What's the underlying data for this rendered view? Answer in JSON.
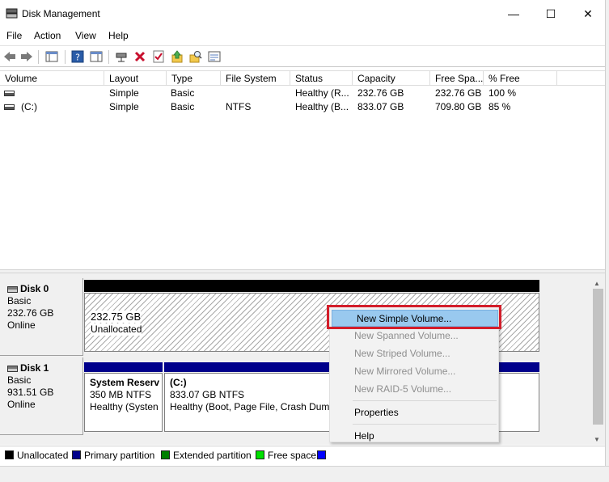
{
  "window": {
    "title": "Disk Management",
    "controls": {
      "minimize": "—",
      "maximize": "☐",
      "close": "✕"
    }
  },
  "menu": [
    "File",
    "Action",
    "View",
    "Help"
  ],
  "volume_list": {
    "columns": [
      "Volume",
      "Layout",
      "Type",
      "File System",
      "Status",
      "Capacity",
      "Free Spa...",
      "% Free"
    ],
    "rows": [
      {
        "volume": "",
        "layout": "Simple",
        "type": "Basic",
        "file_system": "",
        "status": "Healthy (R...",
        "capacity": "232.76 GB",
        "free": "232.76 GB",
        "pct_free": "100 %"
      },
      {
        "volume": "(C:)",
        "layout": "Simple",
        "type": "Basic",
        "file_system": "NTFS",
        "status": "Healthy (B...",
        "capacity": "833.07 GB",
        "free": "709.80 GB",
        "pct_free": "85 %"
      }
    ]
  },
  "disks": [
    {
      "name": "Disk 0",
      "type": "Basic",
      "size": "232.76 GB",
      "state": "Online",
      "partitions": [
        {
          "size": "232.75 GB",
          "label": "Unallocated"
        }
      ]
    },
    {
      "name": "Disk 1",
      "type": "Basic",
      "size": "931.51 GB",
      "state": "Online",
      "partitions": [
        {
          "title": "System Reserv",
          "size": "350 MB NTFS",
          "status": "Healthy (Systen"
        },
        {
          "title": "(C:)",
          "size": "833.07 GB NTFS",
          "status": "Healthy (Boot, Page File, Crash Dump"
        }
      ]
    }
  ],
  "legend": {
    "items": [
      "Unallocated",
      "Primary partition",
      "Extended partition",
      "Free space"
    ],
    "colors": [
      "#000000",
      "#00008b",
      "#008000",
      "#00e000",
      "#0000ff"
    ]
  },
  "context_menu": {
    "items": [
      "New Simple Volume...",
      "New Spanned Volume...",
      "New Striped Volume...",
      "New Mirrored Volume...",
      "New RAID-5 Volume..."
    ],
    "properties": "Properties",
    "help": "Help",
    "highlighted": "New Simple Volume..."
  },
  "colors": {
    "highlight": "#99c9ef",
    "annotation": "#d31d2a",
    "primary_bar": "#00008b"
  }
}
